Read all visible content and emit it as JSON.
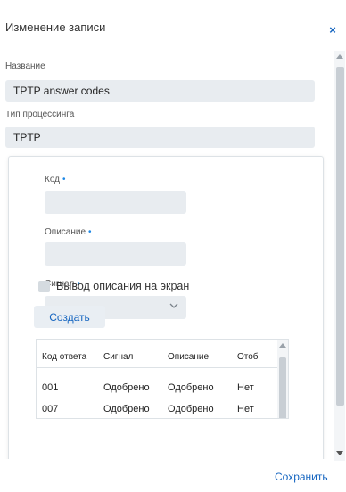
{
  "dialog": {
    "title": "Изменение записи",
    "close_label": "×"
  },
  "fields": {
    "name_label": "Название",
    "name_value": "TPTP answer codes",
    "processing_label": "Тип процессинга",
    "processing_value": "TPTP"
  },
  "form": {
    "code_label": "Код",
    "description_label": "Описание",
    "signal_label": "Сигнал",
    "required_mark": "•",
    "code_value": "",
    "description_value": "",
    "signal_value": "",
    "show_description_label": "Вывод описания на экран",
    "show_description_checked": false,
    "create_label": "Создать"
  },
  "table": {
    "headers": [
      "Код ответа",
      "Сигнал",
      "Описание",
      "Отоб"
    ],
    "rows": [
      [
        "001",
        "Одобрено",
        "Одобрено",
        "Нет"
      ],
      [
        "007",
        "Одобрено",
        "Одобрено",
        "Нет"
      ]
    ]
  },
  "footer": {
    "save_label": "Сохранить"
  },
  "colors": {
    "accent": "#1565c0",
    "required": "#1e88e5",
    "field_bg": "#e8ecf0"
  }
}
